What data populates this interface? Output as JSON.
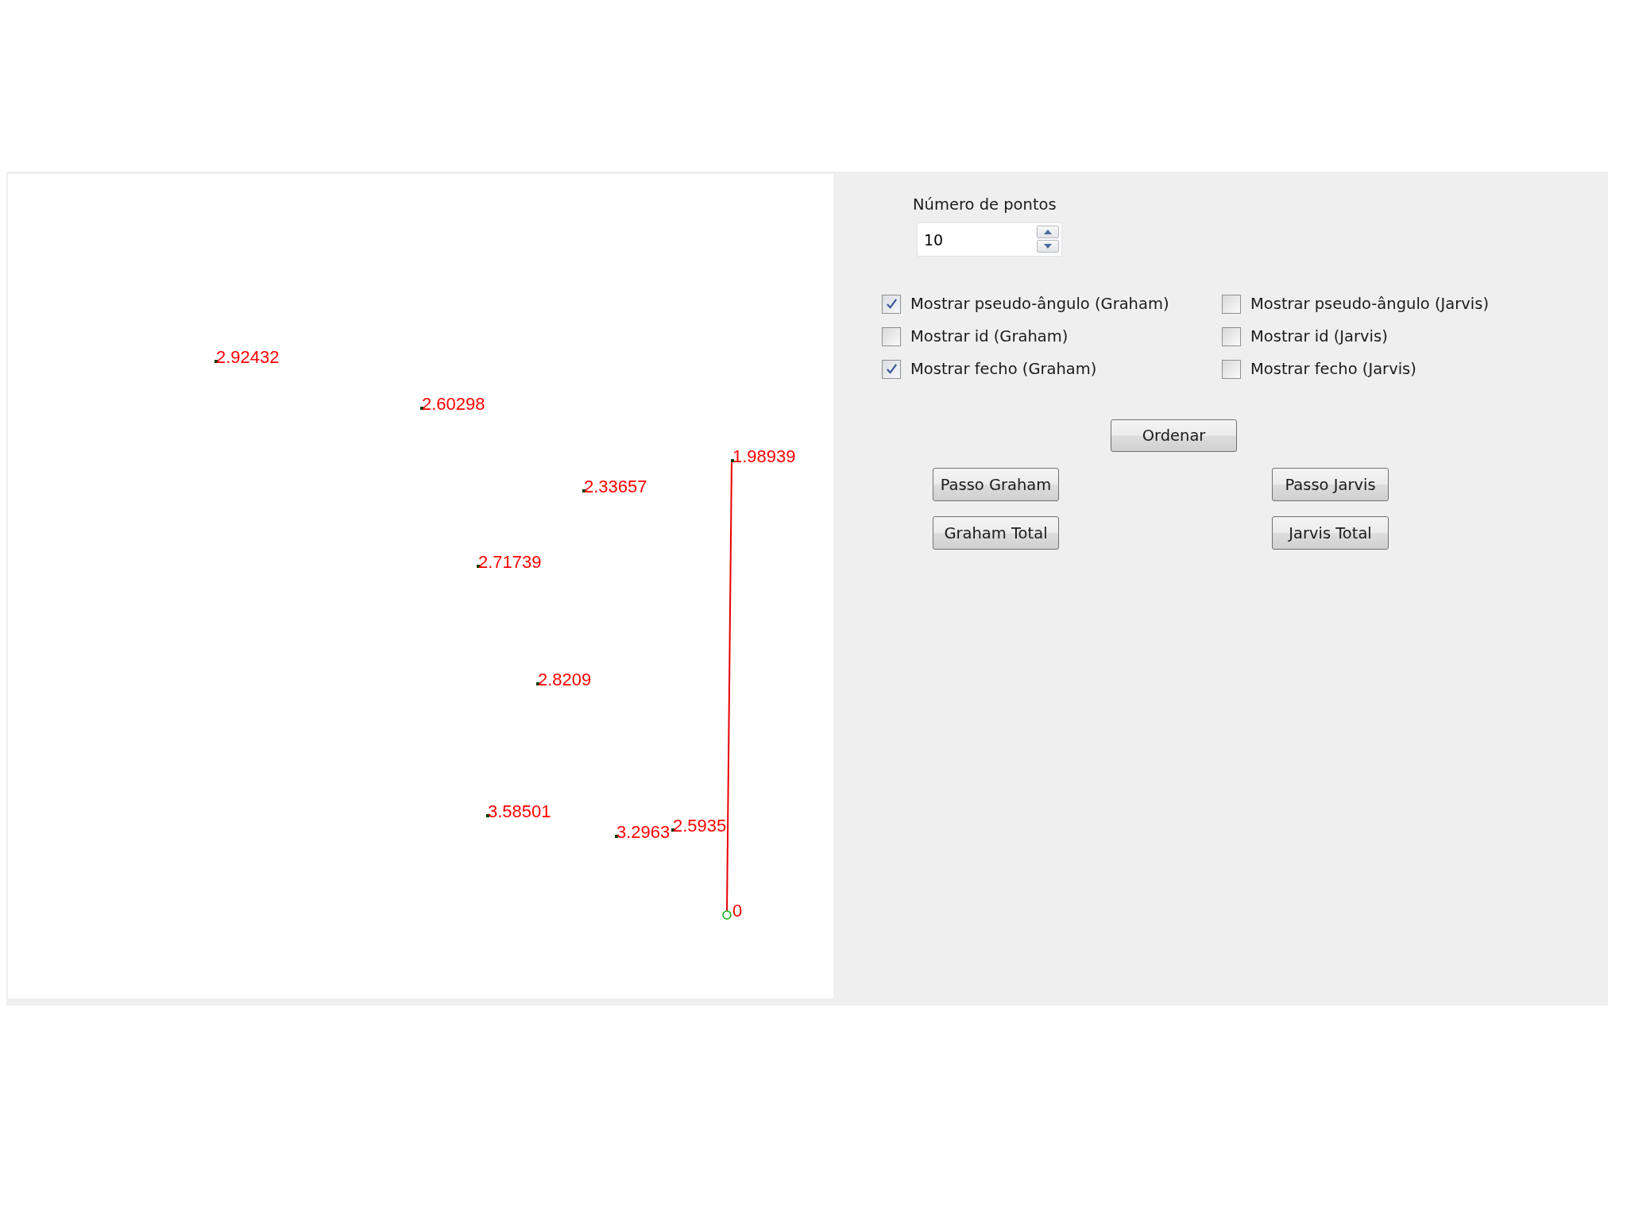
{
  "canvas": {
    "points": [
      {
        "kind": "point",
        "label": "2.92432"
      },
      {
        "kind": "point",
        "label": "2.60298"
      },
      {
        "kind": "point",
        "label": "1.98939"
      },
      {
        "kind": "point",
        "label": "2.33657"
      },
      {
        "kind": "point",
        "label": "2.71739"
      },
      {
        "kind": "point",
        "label": "2.8209"
      },
      {
        "kind": "point",
        "label": "3.58501"
      },
      {
        "kind": "point",
        "label": "3.2963"
      },
      {
        "kind": "point",
        "label": "2.5935"
      },
      {
        "kind": "pivot",
        "label": "0"
      }
    ]
  },
  "point_count": {
    "label": "Número de pontos",
    "value": "10"
  },
  "checkbox_columns": [
    {
      "options": [
        {
          "label": "Mostrar pseudo-ângulo (Graham)",
          "checked": true
        },
        {
          "label": "Mostrar id (Graham)",
          "checked": false
        },
        {
          "label": "Mostrar fecho (Graham)",
          "checked": true
        }
      ]
    },
    {
      "options": [
        {
          "label": "Mostrar pseudo-ângulo (Jarvis)",
          "checked": false
        },
        {
          "label": "Mostrar id (Jarvis)",
          "checked": false
        },
        {
          "label": "Mostrar fecho (Jarvis)",
          "checked": false
        }
      ]
    }
  ],
  "sort_button": "Ordenar",
  "button_columns": [
    [
      "Passo Graham",
      "Graham Total"
    ],
    [
      "Passo Jarvis",
      "Jarvis Total"
    ]
  ]
}
